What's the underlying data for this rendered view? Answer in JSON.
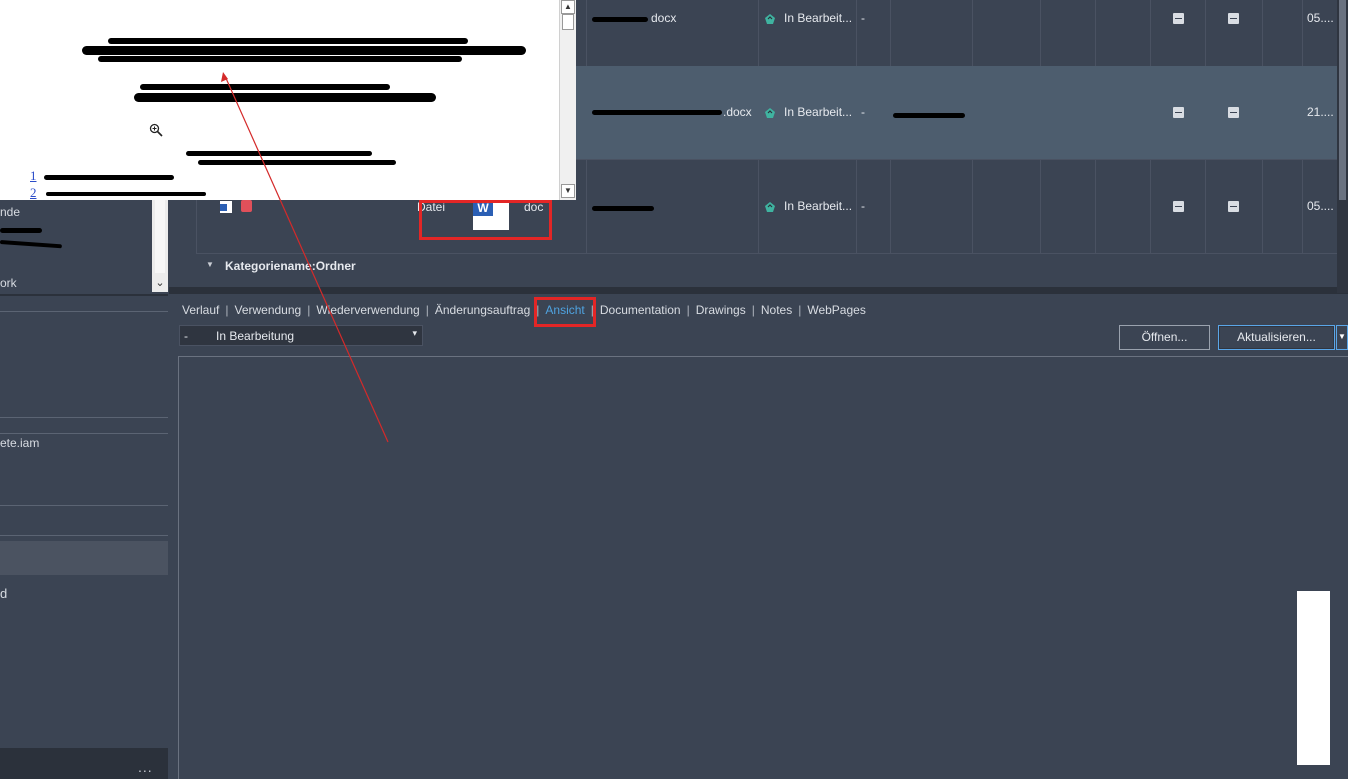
{
  "left_panel": {
    "items": [
      "nde",
      "ork",
      "ete.iam",
      "d"
    ],
    "more_label": "..."
  },
  "grid": {
    "rows": [
      {
        "name_suffix": "docx",
        "status": "In Bearbeit...",
        "rev": "-",
        "date": "05...."
      },
      {
        "name_suffix": ".docx",
        "status": "In Bearbeit...",
        "rev": "-",
        "date": "21...."
      },
      {
        "name_suffix": "",
        "status": "In Bearbeit...",
        "rev": "-",
        "date": "05....",
        "type_left": "Datei",
        "type_right": "doc"
      }
    ],
    "group_label": "Kategoriename:Ordner"
  },
  "preview": {
    "toc_nums": [
      "1",
      "2"
    ]
  },
  "tabs": [
    {
      "label": "Verlauf",
      "active": false
    },
    {
      "label": "Verwendung",
      "active": false
    },
    {
      "label": "Wiederverwendung",
      "active": false
    },
    {
      "label": "Änderungsauftrag",
      "active": false
    },
    {
      "label": "Ansicht",
      "active": true
    },
    {
      "label": "Documentation",
      "active": false
    },
    {
      "label": "Drawings",
      "active": false
    },
    {
      "label": "Notes",
      "active": false
    },
    {
      "label": "WebPages",
      "active": false
    }
  ],
  "toolbar": {
    "state_dash": "-",
    "state_value": "In Bearbeitung",
    "open_label": "Öffnen...",
    "update_label": "Aktualisieren..."
  },
  "colors": {
    "accent": "#4fa3e0",
    "highlight": "#e32626",
    "background": "#3b4453"
  }
}
